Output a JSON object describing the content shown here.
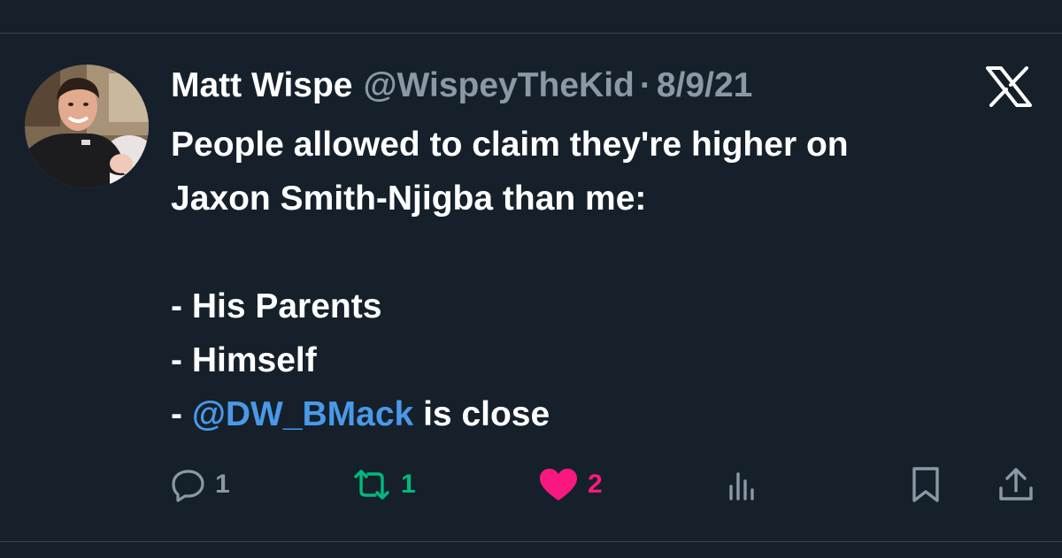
{
  "tweet": {
    "author": {
      "display_name": "Matt Wispe",
      "handle": "@WispeyTheKid"
    },
    "separator": "·",
    "date": "8/9/21",
    "text": {
      "line1": "People allowed to claim they're higher on",
      "line2": "Jaxon Smith-Njigba than me:",
      "item1": "- His Parents",
      "item2": "- Himself",
      "item3_prefix": "- ",
      "item3_mention": "@DW_BMack",
      "item3_suffix": " is close"
    },
    "metrics": {
      "replies": "1",
      "retweets": "1",
      "likes": "2"
    }
  },
  "icons": {
    "logo": "x-logo-icon",
    "reply": "reply-icon",
    "retweet": "retweet-icon",
    "like": "heart-icon",
    "views": "views-icon",
    "bookmark": "bookmark-icon",
    "share": "share-icon"
  },
  "colors": {
    "background": "#15202b",
    "text": "#ffffff",
    "secondary": "#8b98a5",
    "mention": "#4a99e9",
    "retweet": "#00ba7c",
    "like": "#f91880",
    "divider": "#38444d"
  }
}
